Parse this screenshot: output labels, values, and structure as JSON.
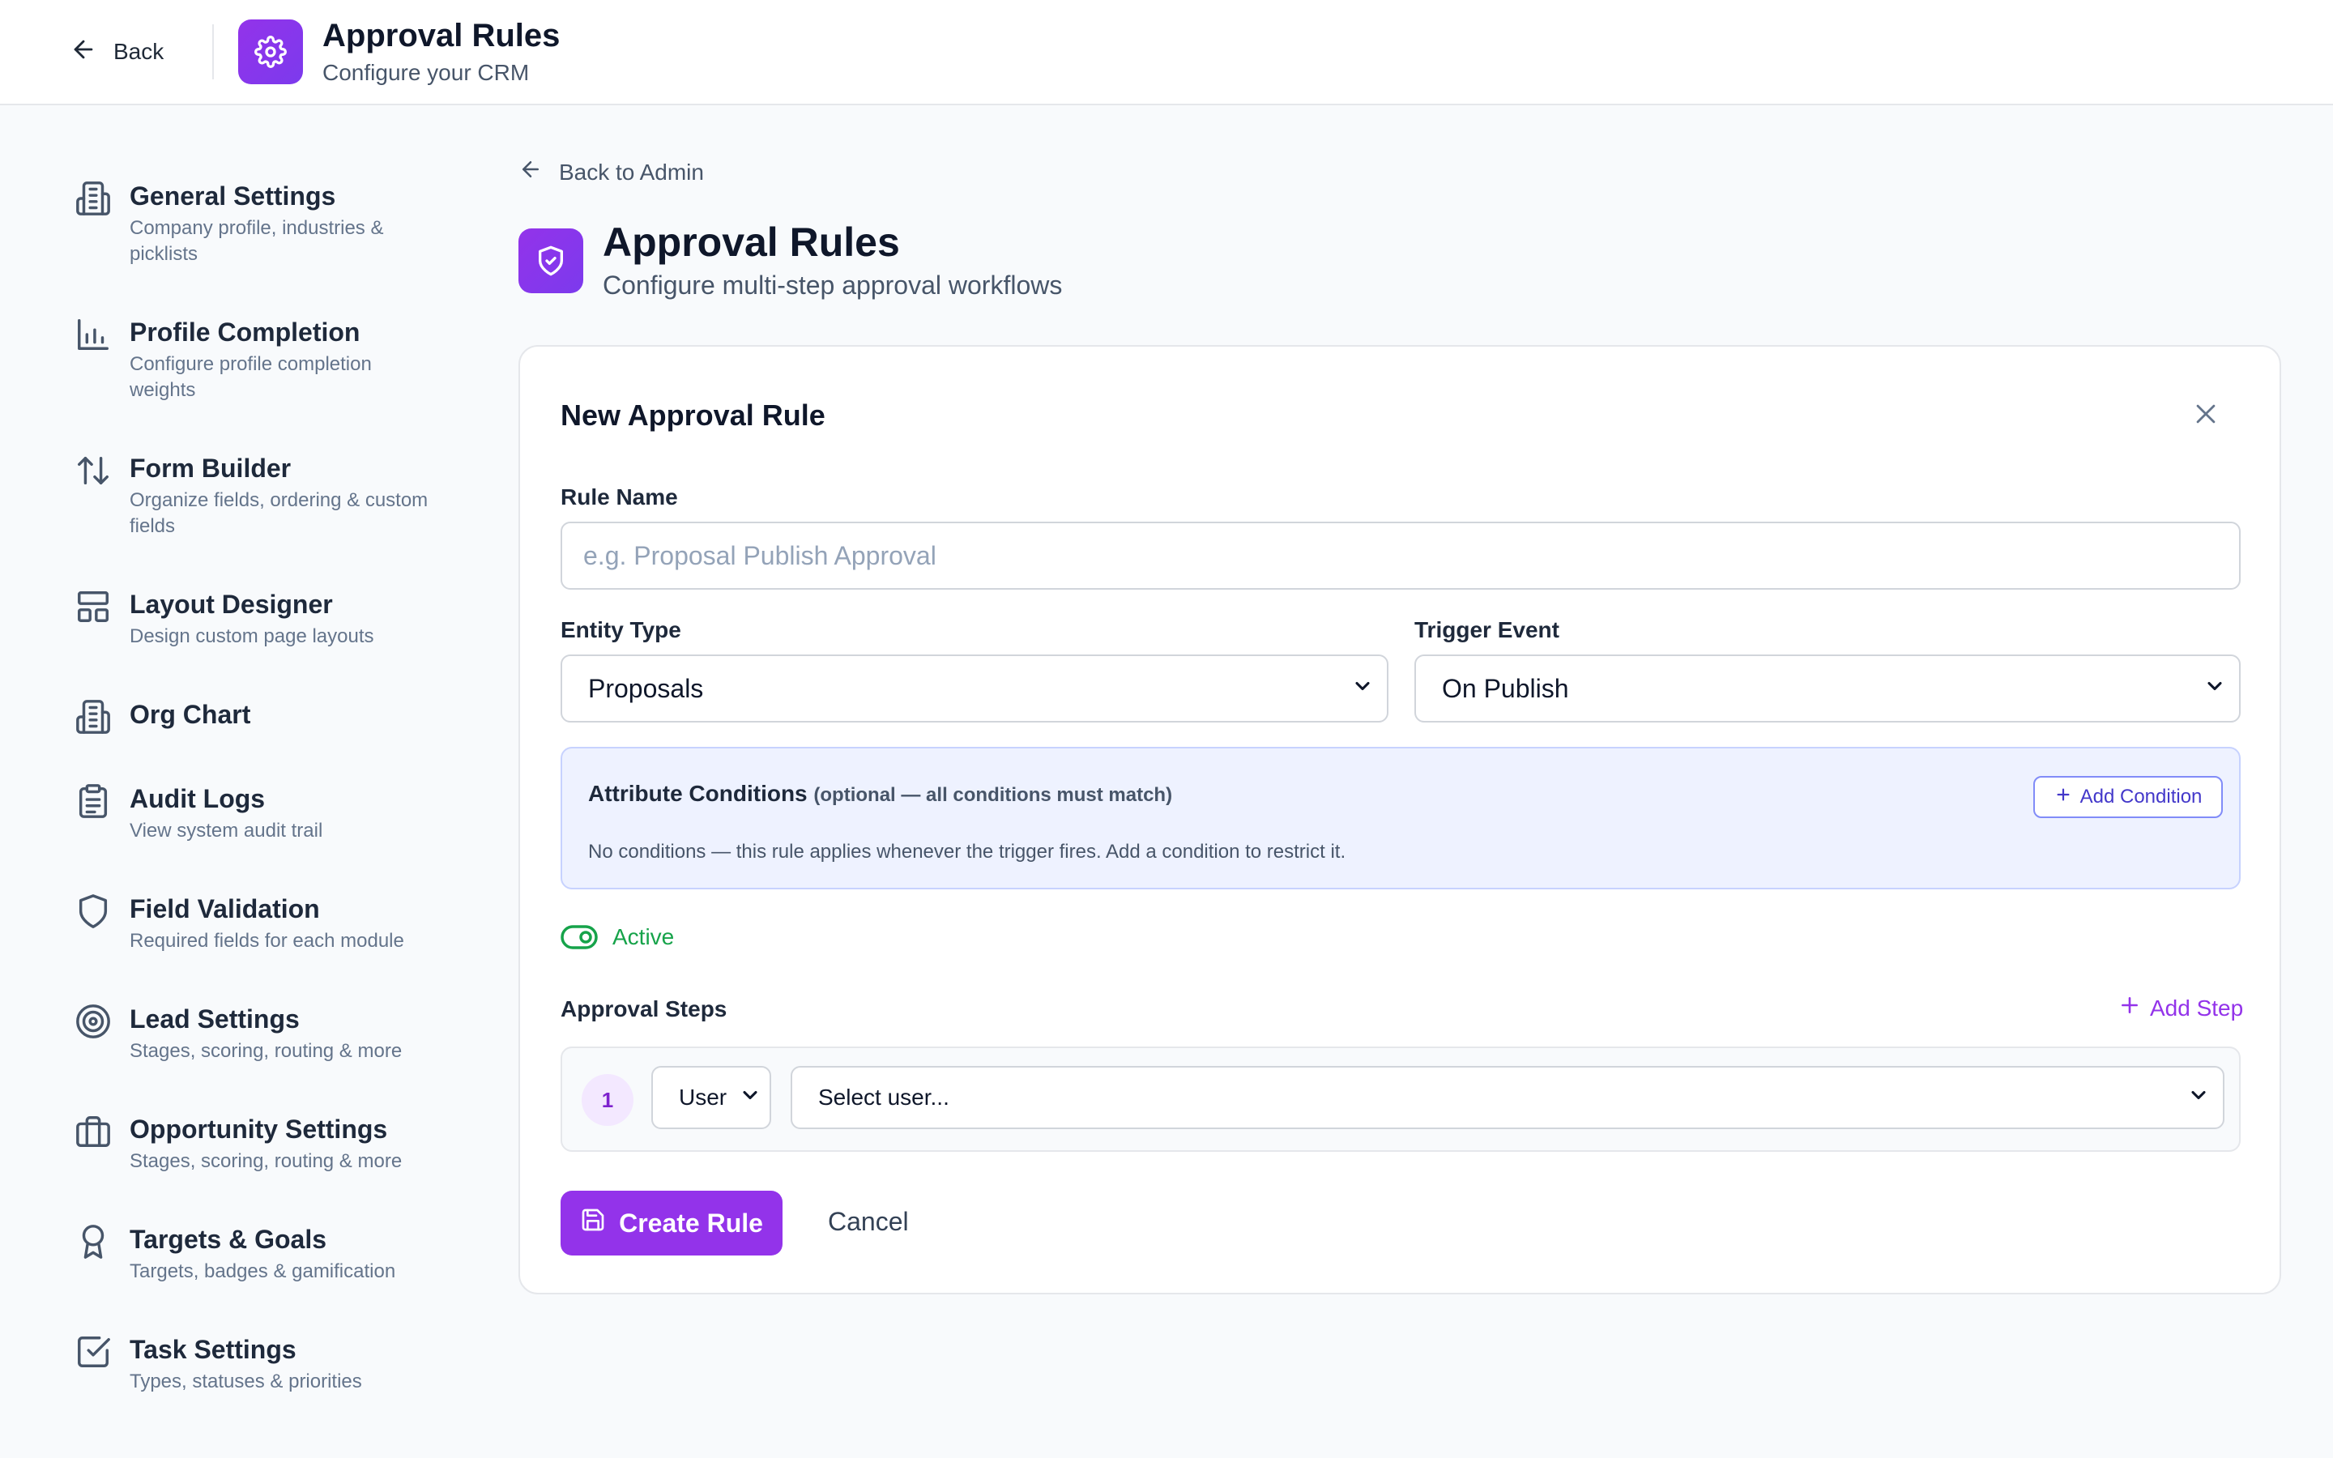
{
  "header": {
    "back_label": "Back",
    "title": "Approval Rules",
    "subtitle": "Configure your CRM",
    "app_icon": "gear-icon"
  },
  "sidebar": {
    "items": [
      {
        "label": "General Settings",
        "description": "Company profile, industries & picklists",
        "icon": "building-icon"
      },
      {
        "label": "Profile Completion",
        "description": "Configure profile completion weights",
        "icon": "bar-chart-icon"
      },
      {
        "label": "Form Builder",
        "description": "Organize fields, ordering & custom fields",
        "icon": "arrows-up-down-icon"
      },
      {
        "label": "Layout Designer",
        "description": "Design custom page layouts",
        "icon": "layout-icon"
      },
      {
        "label": "Org Chart",
        "description": "",
        "icon": "building-icon"
      },
      {
        "label": "Audit Logs",
        "description": "View system audit trail",
        "icon": "clipboard-icon"
      },
      {
        "label": "Field Validation",
        "description": "Required fields for each module",
        "icon": "shield-icon"
      },
      {
        "label": "Lead Settings",
        "description": "Stages, scoring, routing & more",
        "icon": "target-icon"
      },
      {
        "label": "Opportunity Settings",
        "description": "Stages, scoring, routing & more",
        "icon": "briefcase-icon"
      },
      {
        "label": "Targets & Goals",
        "description": "Targets, badges & gamification",
        "icon": "award-icon"
      },
      {
        "label": "Task Settings",
        "description": "Types, statuses & priorities",
        "icon": "check-square-icon"
      }
    ]
  },
  "main": {
    "back_link": "Back to Admin",
    "title": "Approval Rules",
    "subtitle": "Configure multi-step approval workflows",
    "page_icon": "shield-check-icon"
  },
  "form": {
    "title": "New Approval Rule",
    "rule_name_label": "Rule Name",
    "rule_name_placeholder": "e.g. Proposal Publish Approval",
    "rule_name_value": "",
    "entity_type_label": "Entity Type",
    "entity_type_value": "Proposals",
    "trigger_event_label": "Trigger Event",
    "trigger_event_value": "On Publish",
    "conditions": {
      "title": "Attribute Conditions",
      "hint": "(optional — all conditions must match)",
      "empty_text": "No conditions — this rule applies whenever the trigger fires. Add a condition to restrict it.",
      "add_label": "Add Condition"
    },
    "active_label": "Active",
    "active": true,
    "steps_label": "Approval Steps",
    "add_step_label": "Add Step",
    "steps": [
      {
        "number": "1",
        "type": "User",
        "user_placeholder": "Select user..."
      }
    ],
    "create_label": "Create Rule",
    "cancel_label": "Cancel"
  },
  "colors": {
    "accent": "#9333ea",
    "active_green": "#16a34a",
    "condition_bg": "#eef2ff"
  }
}
